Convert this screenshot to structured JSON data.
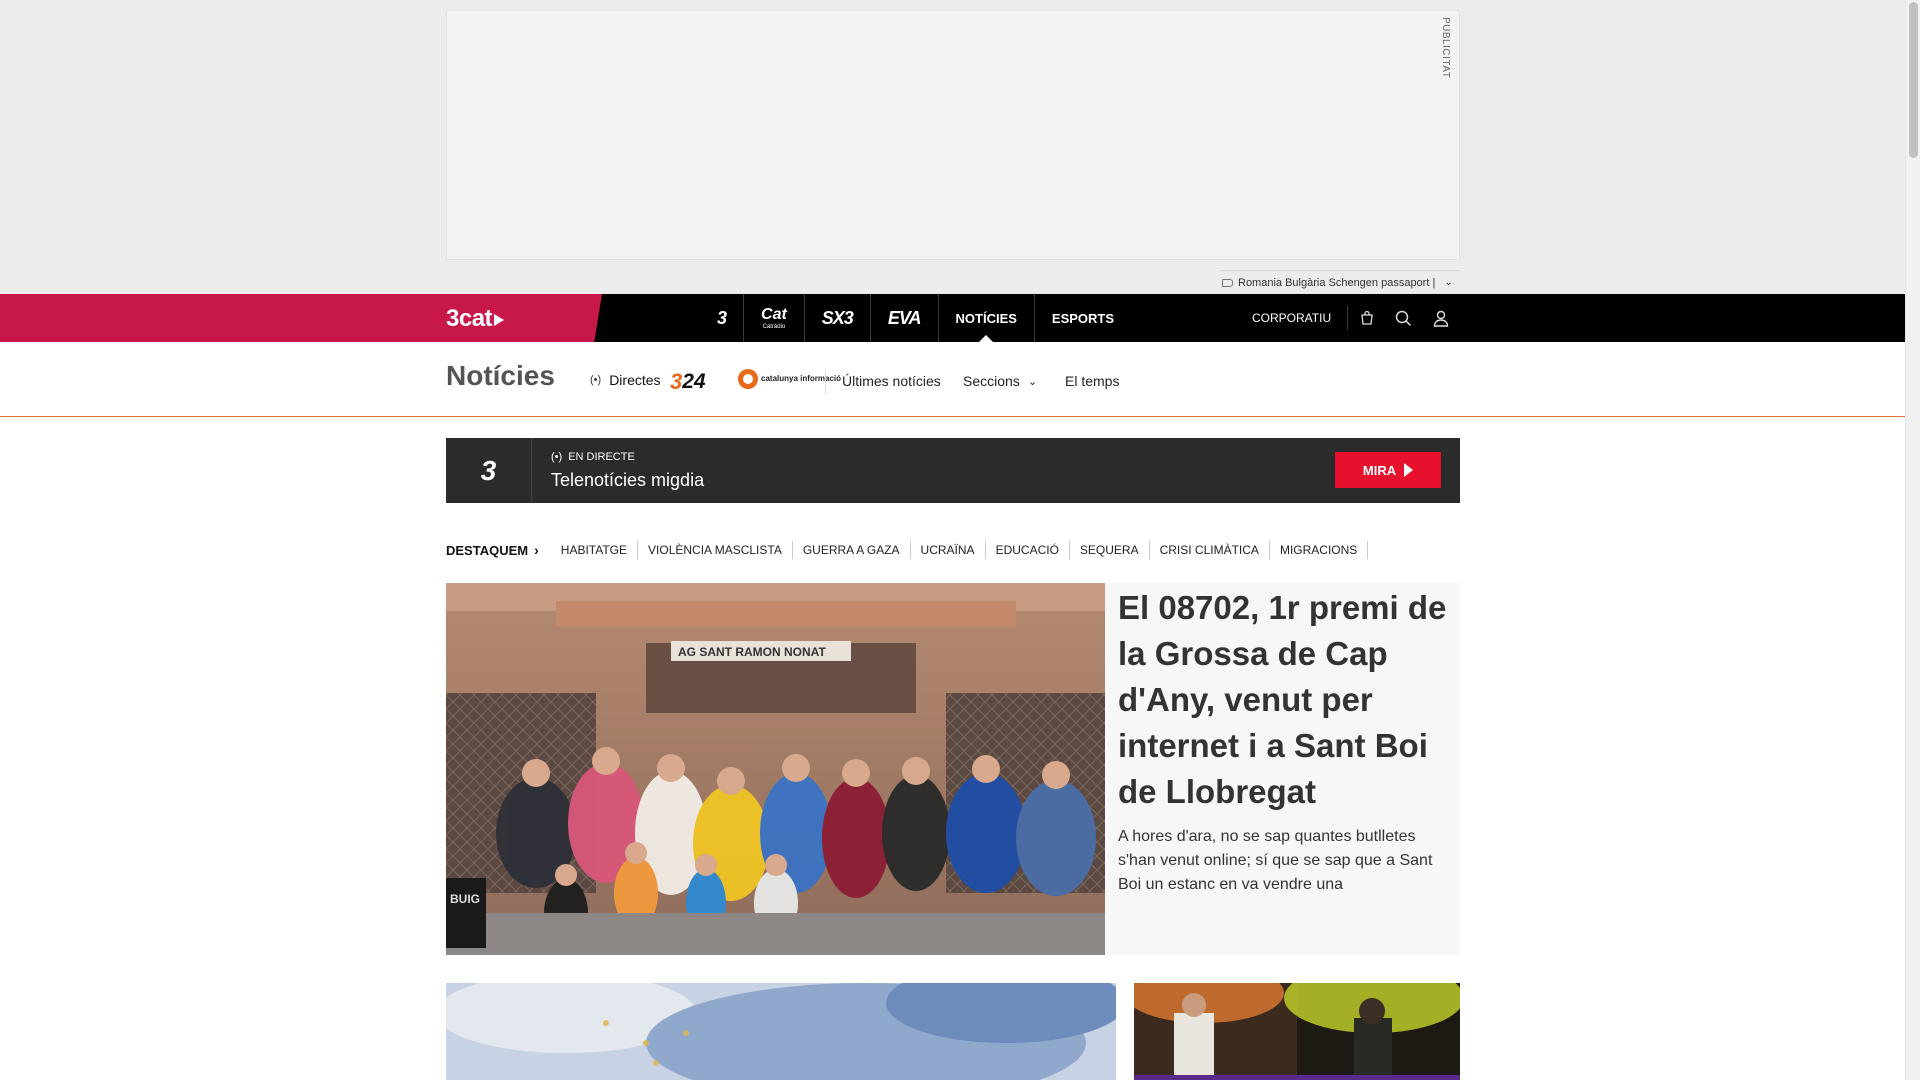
{
  "ad": {
    "vertical_label": "PUBLICITAT",
    "tag_text": "Romania Bulgària Schengen passaport |"
  },
  "topnav": {
    "brand": "3cat",
    "channels": [
      {
        "label": "3",
        "icon": "tv3-logo-icon"
      },
      {
        "label": "Cat",
        "sub": "Catràdio",
        "icon": "catradio-logo-icon"
      },
      {
        "label": "SX3",
        "icon": "sx3-logo-icon"
      },
      {
        "label": "EVA",
        "icon": "eva-logo-icon"
      },
      {
        "label": "NOTÍCIES",
        "active": true
      },
      {
        "label": "ESPORTS"
      }
    ],
    "corporate": "CORPORATIU"
  },
  "section": {
    "title": "Notícies",
    "directes": "Directes",
    "logo_324": "24",
    "logo_324_num": "3",
    "logo_ci_text": "catalunya informació",
    "links": [
      "Últimes notícies",
      "Seccions",
      "El temps"
    ]
  },
  "live": {
    "channel": "3",
    "tag": "EN DIRECTE",
    "title": "Telenotícies migdia",
    "button": "MIRA"
  },
  "highlights": {
    "lead": "DESTAQUEM",
    "tags": [
      "HABITATGE",
      "VIOLÈNCIA MASCLISTA",
      "GUERRA A GAZA",
      "UCRAÏNA",
      "EDUCACIÓ",
      "SEQUERA",
      "CRISI CLIMÀTICA",
      "MIGRACIONS"
    ]
  },
  "featured": {
    "title": "El 08702, 1r premi de la Grossa de Cap d'Any, venut per internet i a Sant Boi de Llobregat",
    "summary": "A hores d'ara, no se sap quantes butlletes s'han venut online; sí que se sap que a Sant Boi un estanc en va vendre una",
    "image_sign": "AG SANT RAMON NONAT",
    "image_sign_2": "BUIG"
  },
  "colors": {
    "brand": "#c8184a",
    "topbar": "#000000",
    "live_bg": "#2b2b2b",
    "mira": "#e8112d",
    "accent_orange": "#e66a1a"
  }
}
